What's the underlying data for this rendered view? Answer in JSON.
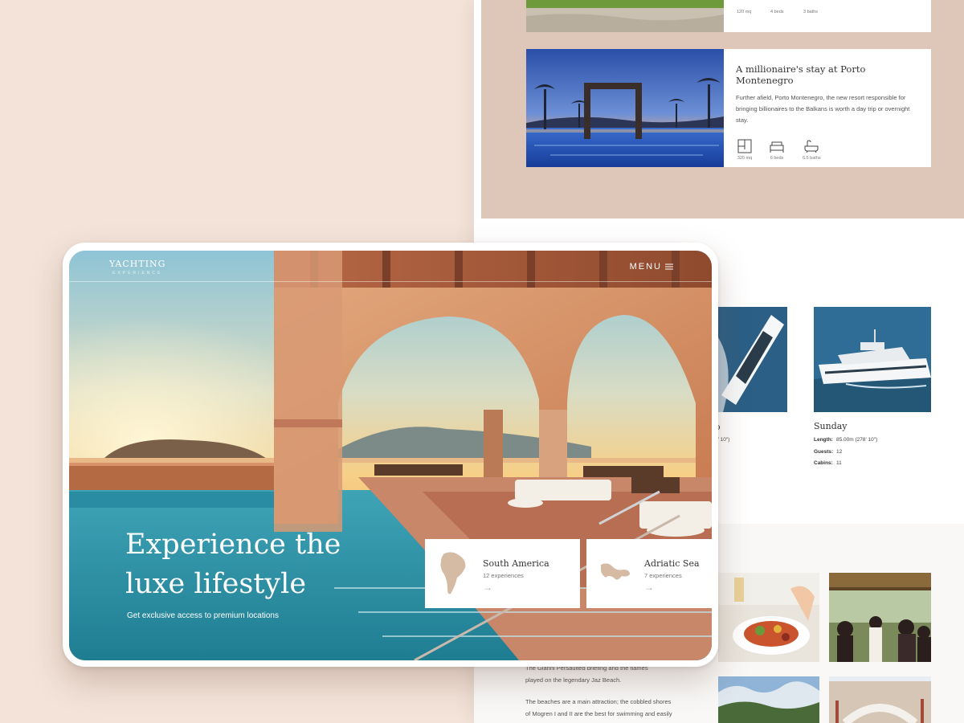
{
  "listings": {
    "top": {
      "amenities": [
        {
          "icon": "floor-plan-icon",
          "label": "120 mq"
        },
        {
          "icon": "bed-icon",
          "label": "4 beds"
        },
        {
          "icon": "bath-icon",
          "label": "3 baths"
        }
      ]
    },
    "main": {
      "title": "A millionaire's stay at Porto Montenegro",
      "description": "Further afield, Porto Montenegro, the new resort responsible for bringing billionaires to the Balkans is worth a day trip or overnight stay.",
      "amenities": [
        {
          "icon": "floor-plan-icon",
          "label": "320 mq"
        },
        {
          "icon": "bed-icon",
          "label": "6 beds"
        },
        {
          "icon": "bath-icon",
          "label": "6.5 baths"
        }
      ]
    }
  },
  "yachts": [
    {
      "name": "o",
      "specs": [
        {
          "label": "",
          "value": "8' 10\")"
        }
      ]
    },
    {
      "name": "Sunday",
      "specs": [
        {
          "label": "Length:",
          "value": "85.00m (278' 10\")"
        },
        {
          "label": "Guests:",
          "value": "12"
        },
        {
          "label": "Cabins:",
          "value": "11"
        }
      ]
    }
  ],
  "article": {
    "p1a": "The Gianni Persaulted briefing and the flames",
    "p1b": "played on the legendary Jaz Beach.",
    "p2a": "The beaches are a main attraction; the cobbled shores",
    "p2b": "of Mogren I and II are the best for swimming and easily"
  },
  "tablet": {
    "logo_main": "YACHTING",
    "logo_sub": "EXPERIENCE",
    "menu_label": "MENU",
    "hero_title": "Experience the luxe lifestyle",
    "hero_subtitle": "Get exclusive access to premium locations",
    "destinations": [
      {
        "name": "South America",
        "count": "12 experiences",
        "icon": "south-america-map-icon"
      },
      {
        "name": "Adriatic Sea",
        "count": "7 experiences",
        "icon": "adriatic-map-icon"
      }
    ]
  }
}
